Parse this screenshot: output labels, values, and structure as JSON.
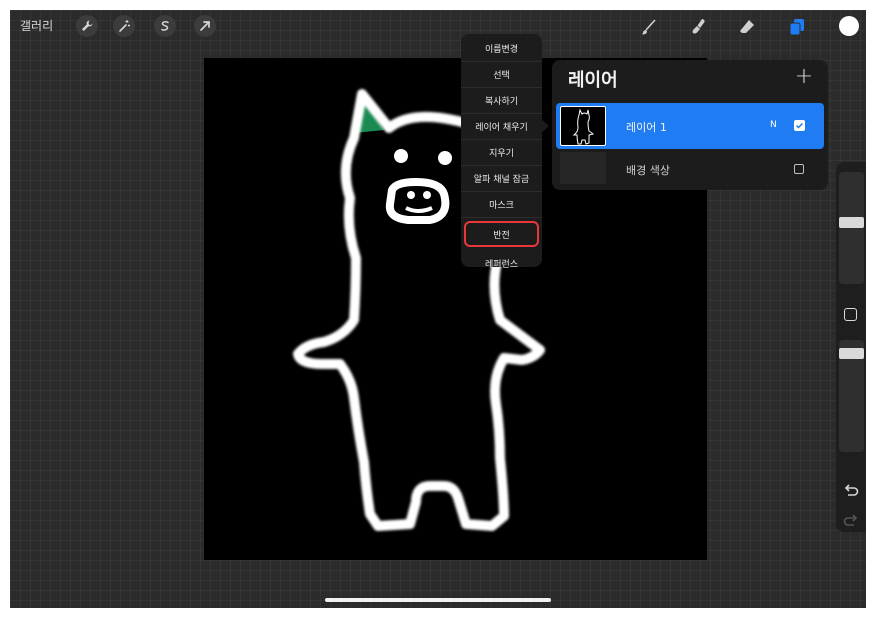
{
  "toolbar": {
    "gallery_label": "갤러리",
    "left_tools": [
      "wrench-icon",
      "magic-wand-icon",
      "selection-icon",
      "transform-arrow-icon"
    ],
    "right_tools": [
      "brush-icon",
      "smudge-icon",
      "eraser-icon",
      "layers-icon"
    ],
    "accent_color": "#1f7cf2",
    "current_color": "#ffffff"
  },
  "context_menu": {
    "items": [
      "이름변경",
      "선택",
      "복사하기",
      "레이어 채우기",
      "지우기",
      "알파 채널 잠금",
      "마스크",
      "반전",
      "레퍼런스"
    ],
    "highlighted_item": "반전",
    "highlight_color": "#e8363a"
  },
  "layers_panel": {
    "title": "레이어",
    "add_label": "+",
    "layers": [
      {
        "name": "레이어 1",
        "mode": "N",
        "visible": true,
        "selected": true
      },
      {
        "name": "배경 색상",
        "mode": "",
        "visible": false,
        "selected": false
      }
    ]
  },
  "sidebar": {
    "brush_size_level": 0.3,
    "opacity_level": 0.08
  }
}
